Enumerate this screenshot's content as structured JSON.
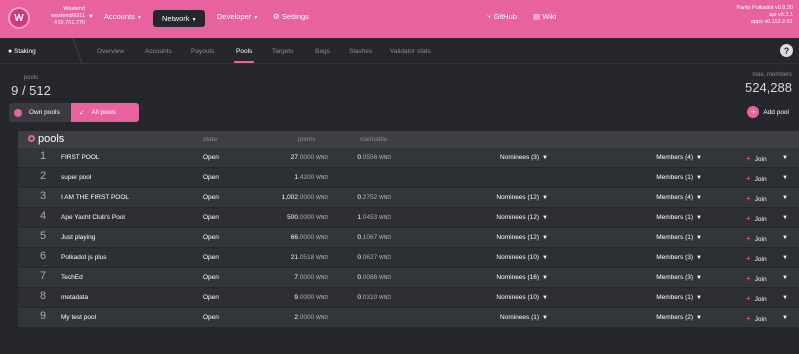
{
  "topbar": {
    "logo_letter": "W",
    "chain_name": "Westend",
    "chain_sub": "westend/9311",
    "block": "#10,761,770",
    "menus": {
      "accounts": "Accounts",
      "network": "Network",
      "developer": "Developer",
      "settings": "Settings"
    },
    "github": "GitHub",
    "wiki": "Wiki",
    "app_name": "Parity Polkadot v0.9.30",
    "api": "api v8.3.1",
    "apps": "apps v0.113.2-51"
  },
  "subnav": {
    "section": "Staking",
    "tabs": [
      "Overview",
      "Accounts",
      "Payouts",
      "Pools",
      "Targets",
      "Bags",
      "Slashes",
      "Validator stats"
    ],
    "active": "Pools"
  },
  "summary": {
    "pools_label": "pools",
    "pools_value": "9 / 512",
    "max_label": "max. members",
    "max_value": "524,288"
  },
  "filters": {
    "own": "Own pools",
    "all": "All pools"
  },
  "add_pool": "Add pool",
  "table": {
    "title": "pools",
    "headers": {
      "state": "state",
      "points": "points",
      "claimable": "claimable"
    },
    "unit": "WND",
    "join_label": "Join",
    "rows": [
      {
        "idx": "1",
        "name": "FIRST POOL",
        "state": "Open",
        "points_int": "27",
        "points_dec": ".0000",
        "claim_int": "0",
        "claim_dec": ".0556",
        "nominees": "Nominees (3)",
        "members": "Members (4)"
      },
      {
        "idx": "2",
        "name": "super pool",
        "state": "Open",
        "points_int": "1",
        "points_dec": ".4200",
        "claim_int": "",
        "claim_dec": "",
        "nominees": "",
        "members": "Members (1)"
      },
      {
        "idx": "3",
        "name": "I AM THE FIRST POOL",
        "state": "Open",
        "points_int": "1,002",
        "points_dec": ".0000",
        "claim_int": "0",
        "claim_dec": ".2752",
        "nominees": "Nominees (12)",
        "members": "Members (4)"
      },
      {
        "idx": "4",
        "name": "Ape Yacht Club's Pool",
        "state": "Open",
        "points_int": "500",
        "points_dec": ".0000",
        "claim_int": "1",
        "claim_dec": ".0453",
        "nominees": "Nominees (12)",
        "members": "Members (1)"
      },
      {
        "idx": "5",
        "name": "Just playing",
        "state": "Open",
        "points_int": "66",
        "points_dec": ".0000",
        "claim_int": "0",
        "claim_dec": ".1067",
        "nominees": "Nominees (12)",
        "members": "Members (1)"
      },
      {
        "idx": "6",
        "name": "Polkadot js plus",
        "state": "Open",
        "points_int": "21",
        "points_dec": ".0518",
        "claim_int": "0",
        "claim_dec": ".0627",
        "nominees": "Nominees (10)",
        "members": "Members (3)"
      },
      {
        "idx": "7",
        "name": "TechEd",
        "state": "Open",
        "points_int": "7",
        "points_dec": ".0000",
        "claim_int": "0",
        "claim_dec": ".0086",
        "nominees": "Nominees (16)",
        "members": "Members (3)"
      },
      {
        "idx": "8",
        "name": "metadata",
        "state": "Open",
        "points_int": "9",
        "points_dec": ".0000",
        "claim_int": "0",
        "claim_dec": ".0310",
        "nominees": "Nominees (10)",
        "members": "Members (1)"
      },
      {
        "idx": "9",
        "name": "My test pool",
        "state": "Open",
        "points_int": "2",
        "points_dec": ".0000",
        "claim_int": "",
        "claim_dec": "",
        "nominees": "Nominees (1)",
        "members": "Members (2)"
      }
    ]
  },
  "colors": {
    "accent": "#e7629f",
    "background": "#26272c"
  }
}
